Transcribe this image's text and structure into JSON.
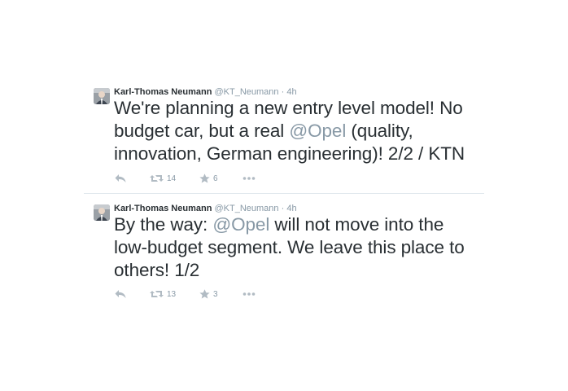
{
  "tweets": [
    {
      "author": "Karl-Thomas Neumann",
      "handle": "@KT_Neumann",
      "separator": "·",
      "time": "4h",
      "text_before": "We're planning a new entry level model! No budget car, but a real ",
      "mention": "@Opel",
      "text_after": " (quality, innovation, German engineering)! 2/2 / KTN",
      "retweets": "14",
      "favorites": "6"
    },
    {
      "author": "Karl-Thomas Neumann",
      "handle": "@KT_Neumann",
      "separator": "·",
      "time": "4h",
      "text_before": "By the way: ",
      "mention": "@Opel",
      "text_after": " will not move into the low-budget segment. We leave this place to others! 1/2",
      "retweets": "13",
      "favorites": "3"
    }
  ],
  "icons": {
    "reply": "reply-icon",
    "retweet": "retweet-icon",
    "favorite": "star-icon",
    "more": "more-icon"
  },
  "colors": {
    "text": "#292f33",
    "muted": "#8899a6",
    "icon": "#b1bbc3",
    "divider": "#e1e8ed"
  }
}
